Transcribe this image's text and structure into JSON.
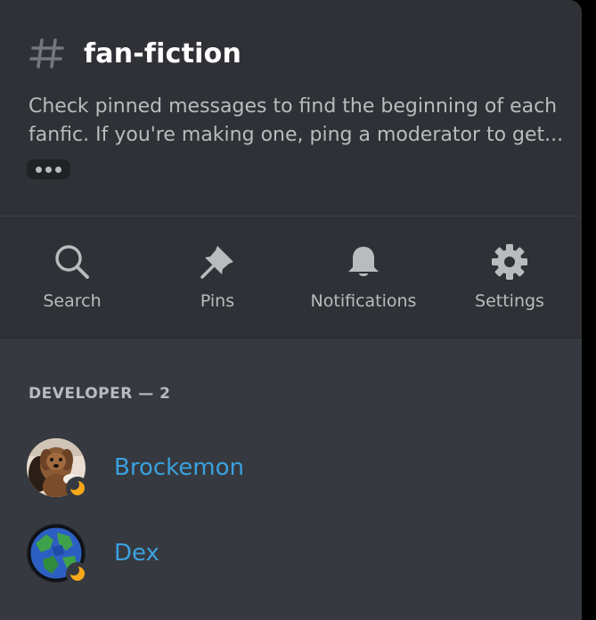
{
  "channel": {
    "name": "fan-fiction",
    "topic_line1": "Check pinned messages to find the beginning of each",
    "topic_line2": "fanfic.  If you're making one, ping a moderator to get..."
  },
  "actions": [
    {
      "label": "Search",
      "icon": "search-icon"
    },
    {
      "label": "Pins",
      "icon": "pin-icon"
    },
    {
      "label": "Notifications",
      "icon": "bell-icon"
    },
    {
      "label": "Settings",
      "icon": "gear-icon"
    }
  ],
  "members_section": {
    "header": "DEVELOPER — 2",
    "members": [
      {
        "name": "Brockemon",
        "status": "idle",
        "avatar": "dog-photo"
      },
      {
        "name": "Dex",
        "status": "idle",
        "avatar": "earth-globe"
      }
    ]
  },
  "colors": {
    "background": "#36393f",
    "header_bg": "#2f3136",
    "member_name": "#3ba1df",
    "idle_status": "#faa81a",
    "text_muted": "#b9bbbe"
  }
}
